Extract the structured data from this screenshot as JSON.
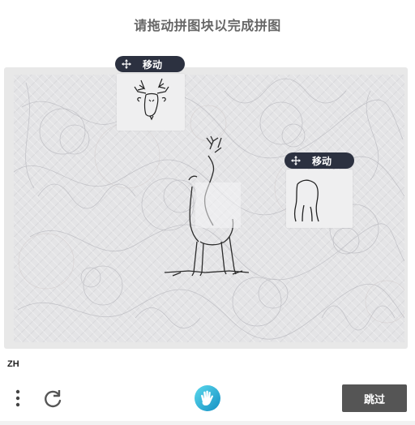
{
  "header": {
    "title": "请拖动拼图块以完成拼图"
  },
  "puzzle": {
    "pieces": [
      {
        "move_label": "移动",
        "move_icon": "move-icon",
        "content": "deer-head"
      },
      {
        "move_label": "移动",
        "move_icon": "move-icon",
        "content": "deer-neck"
      }
    ],
    "background_subject": "deer"
  },
  "footer": {
    "language": "ZH",
    "menu_icon": "more-vertical-icon",
    "reload_icon": "reload-icon",
    "logo_icon": "hand-logo-icon",
    "skip_label": "跳过"
  },
  "colors": {
    "pill": "#2c3140",
    "skip_button": "#555555",
    "logo_accent": "#1fb6d6"
  }
}
